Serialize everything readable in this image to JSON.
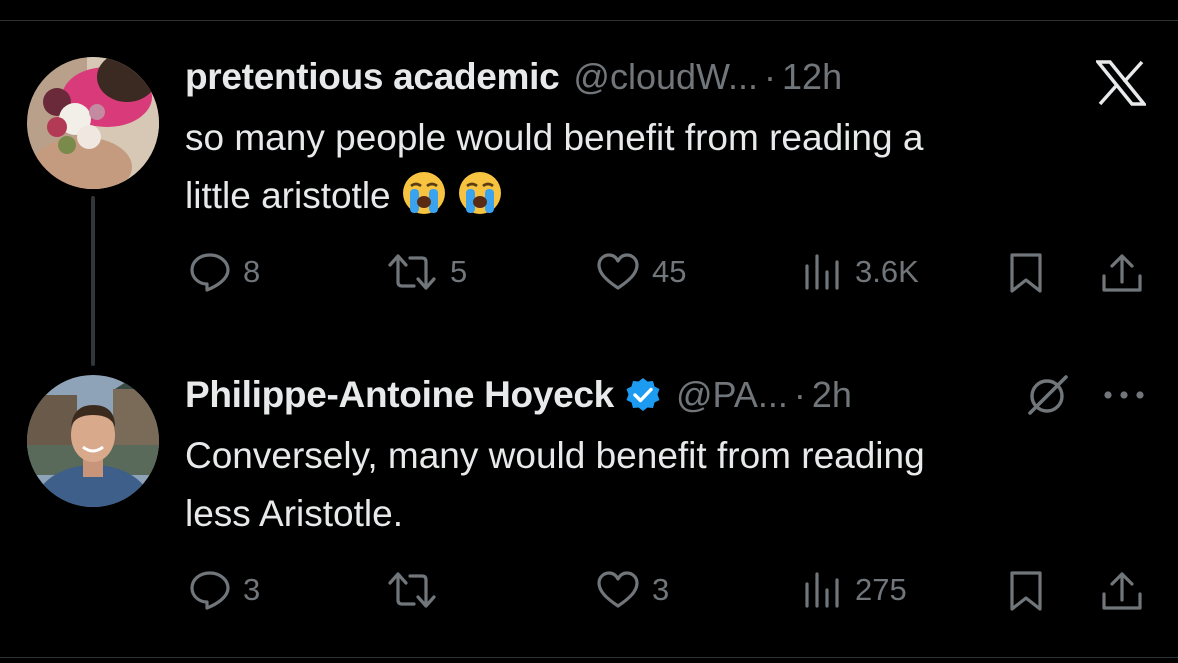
{
  "tweets": [
    {
      "name": "pretentious academic",
      "handle": "@cloudW...",
      "separator": "·",
      "time": "12h",
      "text_lines": [
        "so many people would benefit from reading a",
        "little aristotle"
      ],
      "emojis": [
        "loudly-crying-face",
        "loudly-crying-face"
      ],
      "replies": "8",
      "reposts": "5",
      "likes": "45",
      "views": "3.6K"
    },
    {
      "name": "Philippe-Antoine Hoyeck",
      "verified": true,
      "handle": "@PA...",
      "separator": "·",
      "time": "2h",
      "text_lines": [
        "Conversely, many would benefit from reading",
        "less Aristotle."
      ],
      "replies": "3",
      "reposts": "",
      "likes": "3",
      "views": "275"
    }
  ],
  "colors": {
    "background": "#000000",
    "text_primary": "#e7e9ea",
    "text_secondary": "#71767b",
    "verified_blue": "#1d9bf0",
    "thread_line": "#333639"
  }
}
